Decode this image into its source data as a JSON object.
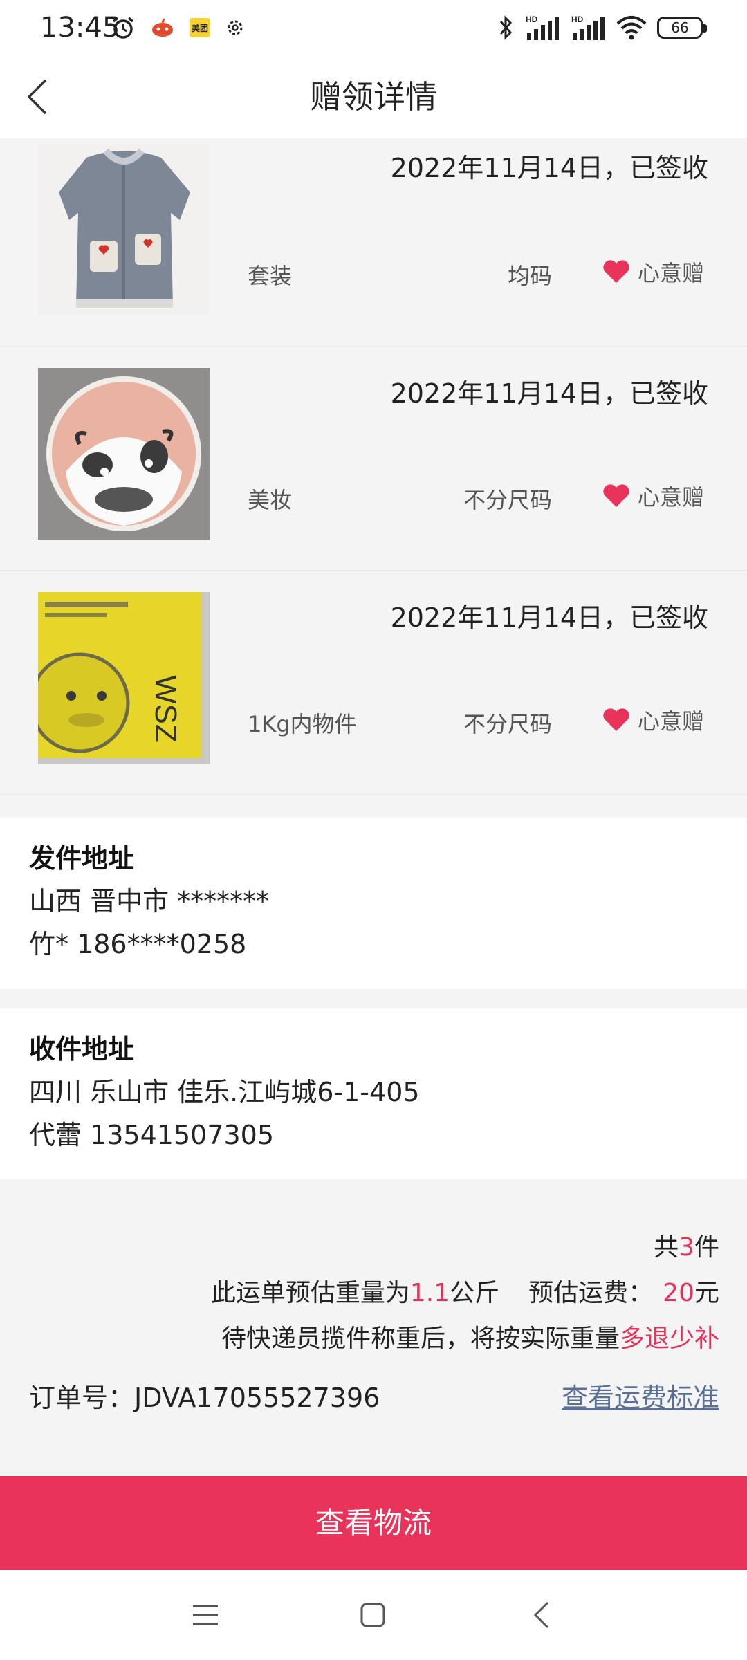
{
  "status_bar": {
    "time": "13:45",
    "meituan_badge": "美团",
    "battery_level": "66",
    "icons": [
      "alarm-icon",
      "app-notification-icon",
      "meituan-icon",
      "settings-icon",
      "bluetooth-icon",
      "hd-signal-icon",
      "hd-signal-icon",
      "wifi-icon",
      "battery-icon"
    ]
  },
  "header": {
    "title": "赠领详情",
    "back_icon": "chevron-left-icon"
  },
  "items": [
    {
      "date_status": "2022年11月14日，已签收",
      "category": "套装",
      "size": "均码",
      "gift_label": "心意赠",
      "image": "robe-photo"
    },
    {
      "date_status": "2022年11月14日，已签收",
      "category": "美妆",
      "size": "不分尺码",
      "gift_label": "心意赠",
      "image": "cushion-compact-photo"
    },
    {
      "date_status": "2022年11月14日，已签收",
      "category": "1Kg内物件",
      "size": "不分尺码",
      "gift_label": "心意赠",
      "image": "yellow-box-photo"
    }
  ],
  "sender": {
    "title": "发件地址",
    "address": "山西 晋中市 *******",
    "contact": "竹* 186****0258"
  },
  "receiver": {
    "title": "收件地址",
    "address": "四川 乐山市 佳乐.江屿城6-1-405",
    "contact": "代蕾 13541507305"
  },
  "summary": {
    "count_prefix": "共",
    "count": "3",
    "count_suffix": "件",
    "weight_prefix": "此运单预估重量为",
    "weight": "1.1",
    "weight_unit": "公斤",
    "fee_prefix": "预估运费：",
    "fee": "20",
    "fee_unit": "元",
    "note_prefix": "待快递员揽件称重后，将按实际重量",
    "note_highlight": "多退少补",
    "order_label": "订单号：",
    "order_number": "JDVA17055527396",
    "fee_standard_link": "查看运费标准"
  },
  "action": {
    "logistics_button": "查看物流"
  },
  "colors": {
    "accent": "#e9335a",
    "link": "#5a6f97",
    "background": "#f4f4f4"
  }
}
